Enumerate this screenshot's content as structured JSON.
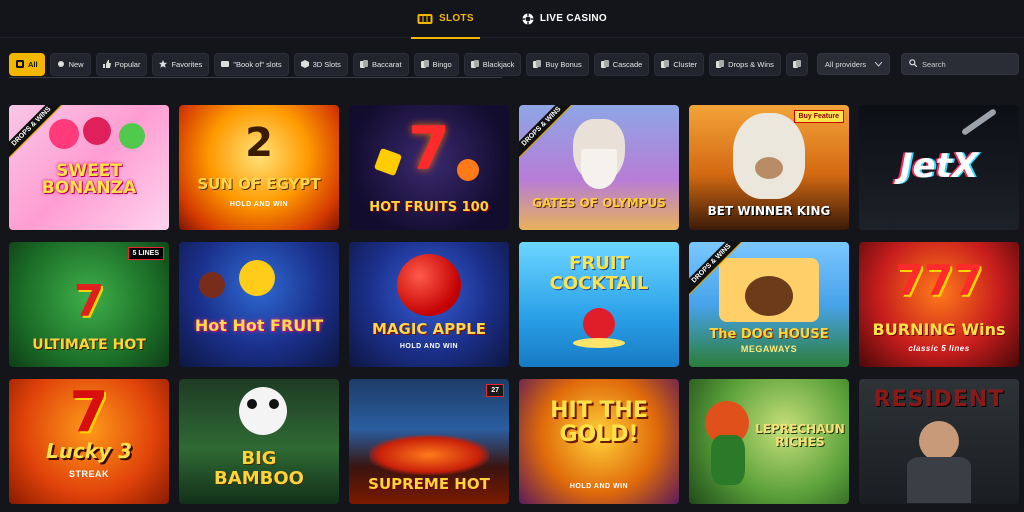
{
  "nav": {
    "tabs": [
      {
        "label": "SLOTS",
        "icon": "slot-machine-icon",
        "active": true
      },
      {
        "label": "LIVE CASINO",
        "icon": "casino-chip-icon",
        "active": false
      }
    ]
  },
  "filters": {
    "chips": [
      {
        "label": "All",
        "icon": "grid-icon",
        "active": true
      },
      {
        "label": "New",
        "icon": "dot-icon"
      },
      {
        "label": "Popular",
        "icon": "thumbs-up-icon"
      },
      {
        "label": "Favorites",
        "icon": "star-icon"
      },
      {
        "label": "\"Book of\" slots",
        "icon": "book-icon"
      },
      {
        "label": "3D Slots",
        "icon": "cube-icon"
      },
      {
        "label": "Baccarat",
        "icon": "cards-icon"
      },
      {
        "label": "Bingo",
        "icon": "bingo-icon"
      },
      {
        "label": "Blackjack",
        "icon": "cards-icon"
      },
      {
        "label": "Buy Bonus",
        "icon": "cart-icon"
      },
      {
        "label": "Cascade",
        "icon": "cascade-icon"
      },
      {
        "label": "Cluster",
        "icon": "cluster-icon"
      },
      {
        "label": "Drops & Wins",
        "icon": "drop-icon"
      },
      {
        "label": "",
        "icon": "more-icon"
      }
    ],
    "providers": {
      "value": "All providers"
    },
    "search": {
      "placeholder": "Search"
    }
  },
  "games": [
    {
      "title": "SWEET BONANZA",
      "sub": "",
      "ribbon": "DROPS & WINS",
      "corner": ""
    },
    {
      "title": "SUN OF EGYPT",
      "sub": "HOLD AND WIN",
      "ribbon": "",
      "corner": "2"
    },
    {
      "title": "HOT FRUITS 100",
      "sub": "",
      "ribbon": "",
      "corner": ""
    },
    {
      "title": "GATES OF OLYMPUS",
      "sub": "",
      "ribbon": "DROPS & WINS",
      "corner": ""
    },
    {
      "title": "BET WINNER KING",
      "sub": "",
      "ribbon": "",
      "corner": "Buy Feature"
    },
    {
      "title": "JetX",
      "sub": "",
      "ribbon": "",
      "corner": ""
    },
    {
      "title": "ULTIMATE HOT",
      "sub": "",
      "ribbon": "",
      "corner": "5 LINES"
    },
    {
      "title": "Hot Hot FRUIT",
      "sub": "",
      "ribbon": "",
      "corner": ""
    },
    {
      "title": "MAGIC APPLE",
      "sub": "HOLD AND WIN",
      "ribbon": "",
      "corner": ""
    },
    {
      "title": "FRUIT COCKTAIL",
      "sub": "",
      "ribbon": "",
      "corner": ""
    },
    {
      "title": "The DOG HOUSE",
      "sub": "MEGAWAYS",
      "ribbon": "DROPS & WINS",
      "corner": ""
    },
    {
      "title": "BURNING Wins",
      "sub": "classic 5 lines",
      "ribbon": "",
      "corner": ""
    },
    {
      "title": "Lucky 3",
      "sub": "STREAK",
      "ribbon": "",
      "corner": ""
    },
    {
      "title": "BIG BAMBOO",
      "sub": "",
      "ribbon": "",
      "corner": ""
    },
    {
      "title": "SUPREME HOT",
      "sub": "",
      "ribbon": "",
      "corner": "27"
    },
    {
      "title": "HIT THE GOLD!",
      "sub": "HOLD AND WIN",
      "ribbon": "",
      "corner": ""
    },
    {
      "title": "LEPRECHAUN RICHES",
      "sub": "",
      "ribbon": "",
      "corner": ""
    },
    {
      "title": "RESIDENT",
      "sub": "",
      "ribbon": "",
      "corner": ""
    }
  ],
  "colors": {
    "accent": "#f3b700",
    "bg": "#13151b",
    "chip": "#22252d"
  }
}
